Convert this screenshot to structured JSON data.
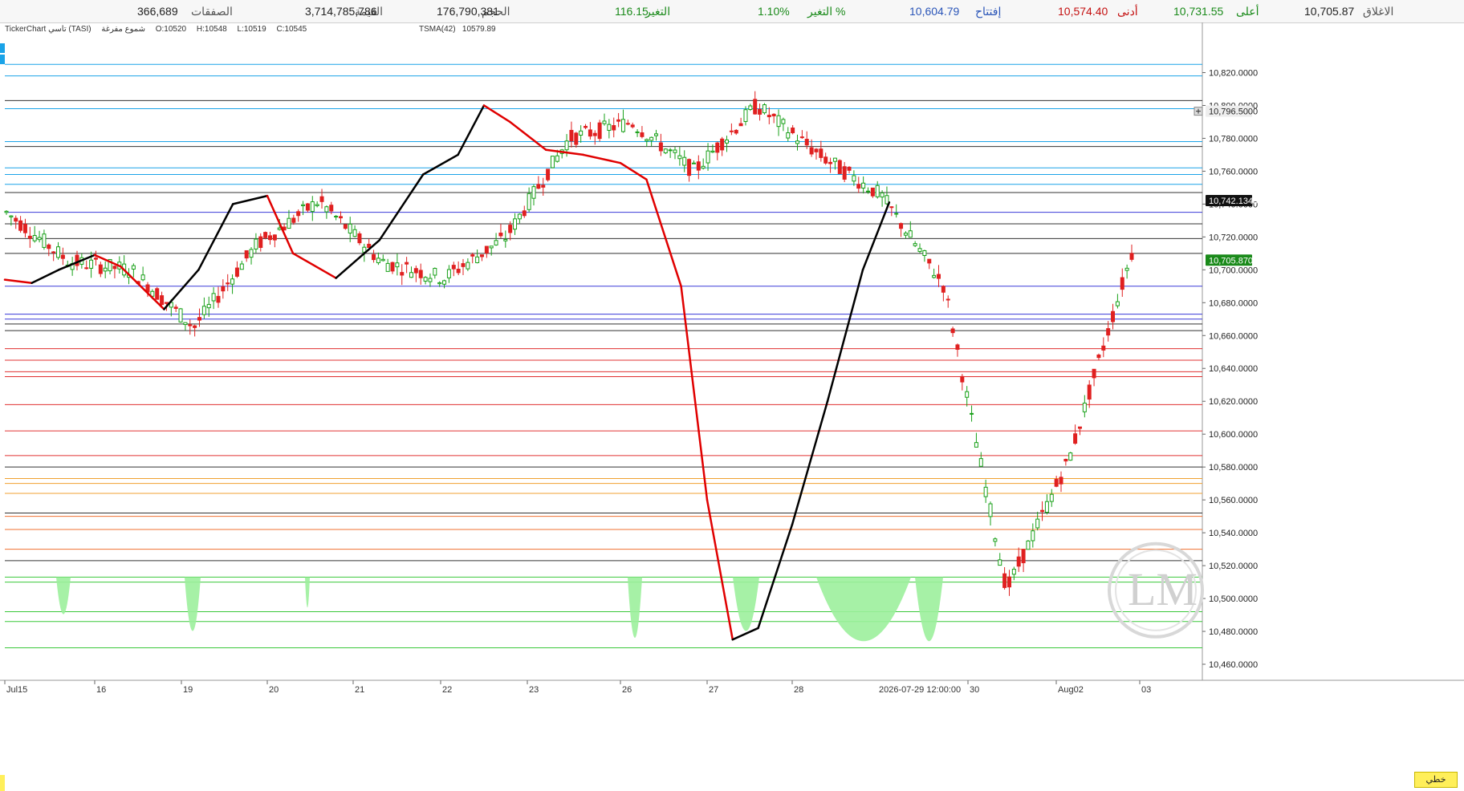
{
  "header": {
    "stats": [
      {
        "label": "الاغلاق",
        "value": "10,705.87",
        "color": "#222222"
      },
      {
        "label": "أعلى",
        "value": "10,731.55",
        "color": "#1a8a1a"
      },
      {
        "label": "أدنى",
        "value": "10,574.40",
        "color": "#c41010"
      },
      {
        "label": "إفتتاح",
        "value": "10,604.79",
        "color": "#2a55b8"
      },
      {
        "label": "التغير %",
        "value": "1.10%",
        "color": "#1a8a1a"
      },
      {
        "label": "التغير",
        "value": "116.15",
        "color": "#1a8a1a"
      },
      {
        "label": "الحجم",
        "value": "176,790,381",
        "color": "#222222"
      },
      {
        "label": "القيمة",
        "value": "3,714,785,786",
        "color": "#222222"
      },
      {
        "label": "الصفقات",
        "value": "366,689",
        "color": "#222222"
      }
    ]
  },
  "info": {
    "symbol": "TickerChart تاسي (TASI)",
    "chart_type": "شموع مفرغة",
    "open": "O:10520",
    "high": "H:10548",
    "low": "L:10519",
    "close": "C:10545",
    "indicator": "TSMA(42)",
    "indicator_value": "10579.89"
  },
  "axis": {
    "price_labels": [
      "10,820.0000",
      "10,800.0000",
      "10,780.0000",
      "10,760.0000",
      "10,740.0000",
      "10,720.0000",
      "10,700.0000",
      "10,680.0000",
      "10,660.0000",
      "10,640.0000",
      "10,620.0000",
      "10,600.0000",
      "10,580.0000",
      "10,560.0000",
      "10,540.0000",
      "10,520.0000",
      "10,500.0000",
      "10,480.0000",
      "10,460.0000"
    ],
    "date_labels": [
      "Jul15",
      "16",
      "19",
      "20",
      "21",
      "22",
      "23",
      "26",
      "27",
      "28",
      "30",
      "Aug02",
      "03"
    ],
    "crosshair_date": "2026-07-29 12:00:00",
    "tags": {
      "crosshair_price": "10,796.5000",
      "indicator_price": "10,742.1345",
      "last_price": "10,705.8700"
    }
  },
  "footer": {
    "mode_button": "خطي"
  },
  "colors": {
    "indicator_up": "#000000",
    "indicator_down": "#e00000",
    "candle_up": "#18a018",
    "candle_down": "#e02020",
    "volume_fill": "#9cf09c"
  },
  "chart_data": {
    "type": "candlestick",
    "ylim": [
      10460,
      10830
    ],
    "x": [
      "Jul15",
      "16",
      "19",
      "20",
      "21",
      "22",
      "23",
      "26",
      "27",
      "28",
      "29",
      "30",
      "Aug02",
      "03"
    ],
    "close_series_approx": [
      10735,
      10705,
      10700,
      10665,
      10715,
      10742,
      10705,
      10695,
      10720,
      10780,
      10790,
      10760,
      10800,
      10770,
      10745,
      10690,
      10505,
      10585,
      10710
    ],
    "indicator_series": {
      "name": "TSMA(42)",
      "points": [
        [
          0,
          10694
        ],
        [
          0.3,
          10692
        ],
        [
          0.6,
          10700
        ],
        [
          1.0,
          10709
        ],
        [
          1.3,
          10702
        ],
        [
          1.8,
          10676
        ],
        [
          2.2,
          10700
        ],
        [
          2.6,
          10740
        ],
        [
          3.0,
          10745
        ],
        [
          3.3,
          10710
        ],
        [
          3.8,
          10695
        ],
        [
          4.3,
          10718
        ],
        [
          4.8,
          10758
        ],
        [
          5.2,
          10770
        ],
        [
          5.5,
          10800
        ],
        [
          5.8,
          10790
        ],
        [
          6.2,
          10773
        ],
        [
          6.6,
          10770
        ],
        [
          7.0,
          10765
        ],
        [
          7.3,
          10755
        ],
        [
          7.7,
          10690
        ],
        [
          8.0,
          10560
        ],
        [
          8.3,
          10475
        ],
        [
          8.6,
          10482
        ],
        [
          9.0,
          10545
        ],
        [
          9.4,
          10620
        ],
        [
          9.8,
          10700
        ],
        [
          10.1,
          10741
        ]
      ]
    },
    "horizontal_levels": [
      {
        "price": 10825,
        "color": "#1aa3e8"
      },
      {
        "price": 10818,
        "color": "#1aa3e8"
      },
      {
        "price": 10803,
        "color": "#333333"
      },
      {
        "price": 10798,
        "color": "#1aa3e8"
      },
      {
        "price": 10778,
        "color": "#1aa3e8"
      },
      {
        "price": 10775,
        "color": "#333333"
      },
      {
        "price": 10762,
        "color": "#1aa3e8"
      },
      {
        "price": 10758,
        "color": "#1aa3e8"
      },
      {
        "price": 10752,
        "color": "#1aa3e8"
      },
      {
        "price": 10747,
        "color": "#333333"
      },
      {
        "price": 10735,
        "color": "#3a3ad8"
      },
      {
        "price": 10728,
        "color": "#333333"
      },
      {
        "price": 10719,
        "color": "#333333"
      },
      {
        "price": 10710,
        "color": "#333333"
      },
      {
        "price": 10690,
        "color": "#3a3ad8"
      },
      {
        "price": 10673,
        "color": "#3a3ad8"
      },
      {
        "price": 10670,
        "color": "#3a3ad8"
      },
      {
        "price": 10667,
        "color": "#333333"
      },
      {
        "price": 10663,
        "color": "#333333"
      },
      {
        "price": 10652,
        "color": "#e03030"
      },
      {
        "price": 10645,
        "color": "#e03030"
      },
      {
        "price": 10638,
        "color": "#e03030"
      },
      {
        "price": 10635,
        "color": "#e03030"
      },
      {
        "price": 10618,
        "color": "#e03030"
      },
      {
        "price": 10602,
        "color": "#e03030"
      },
      {
        "price": 10587,
        "color": "#e03030"
      },
      {
        "price": 10580,
        "color": "#333333"
      },
      {
        "price": 10573,
        "color": "#f0a030"
      },
      {
        "price": 10570,
        "color": "#f0a030"
      },
      {
        "price": 10564,
        "color": "#f0a030"
      },
      {
        "price": 10552,
        "color": "#333333"
      },
      {
        "price": 10550,
        "color": "#f07030"
      },
      {
        "price": 10542,
        "color": "#f07030"
      },
      {
        "price": 10530,
        "color": "#f07030"
      },
      {
        "price": 10523,
        "color": "#333333"
      },
      {
        "price": 10513,
        "color": "#3ac83a"
      },
      {
        "price": 10510,
        "color": "#3ac83a"
      },
      {
        "price": 10492,
        "color": "#3ac83a"
      },
      {
        "price": 10486,
        "color": "#3ac83a"
      },
      {
        "price": 10470,
        "color": "#3ac83a"
      }
    ]
  }
}
